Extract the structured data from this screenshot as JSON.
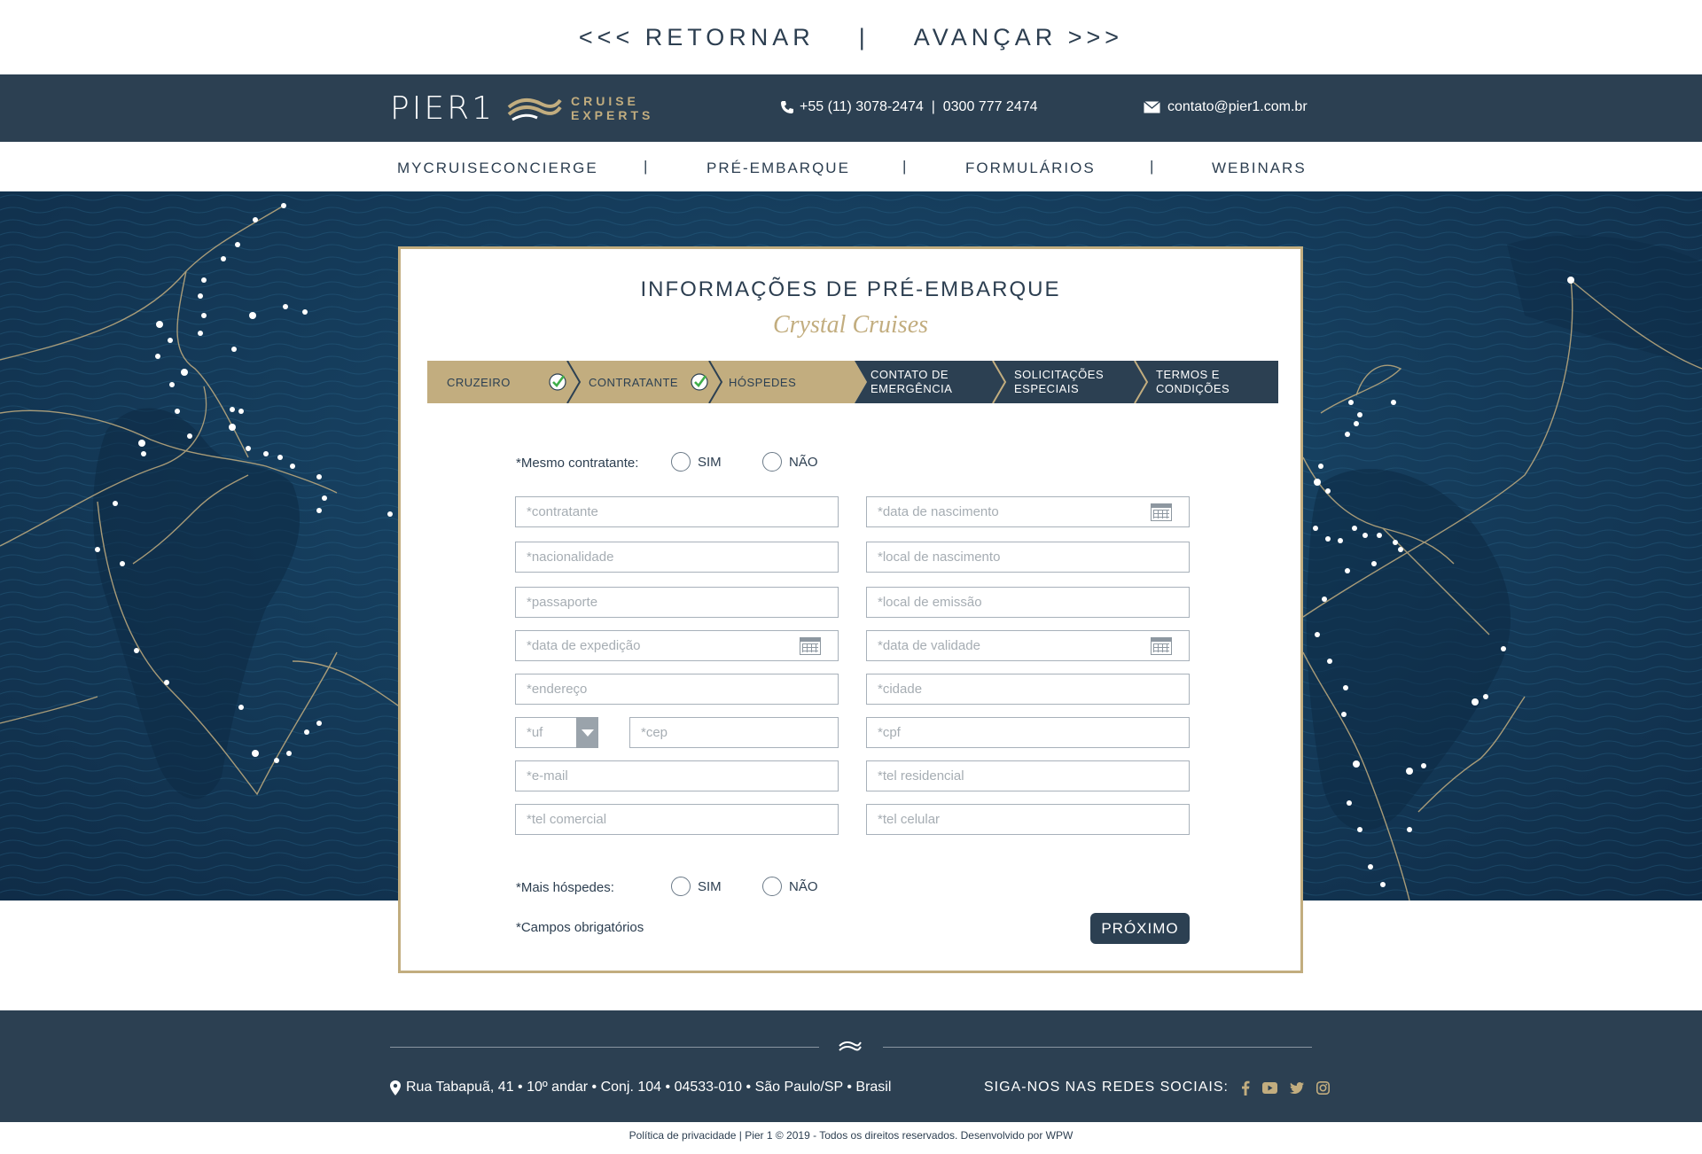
{
  "topnav": {
    "back": "<<< RETORNAR",
    "divider": "|",
    "forward": "AVANÇAR >>>"
  },
  "header": {
    "logo_main": "PIER1",
    "logo_sub_1": "CRUISE",
    "logo_sub_2": "EXPERTS",
    "phone": "+55 (11) 3078-2474  |  0300 777 2474",
    "email": "contato@pier1.com.br"
  },
  "menu": {
    "items": [
      "MYCRUISECONCIERGE",
      "PRÉ-EMBARQUE",
      "FORMULÁRIOS",
      "WEBINARS"
    ],
    "separator": "|"
  },
  "form": {
    "title": "INFORMAÇÕES DE PRÉ-EMBARQUE",
    "subtitle": "Crystal Cruises",
    "steps": [
      {
        "label": "CRUZEIRO",
        "done": true
      },
      {
        "label": "CONTRATANTE",
        "done": true
      },
      {
        "label": "HÓSPEDES",
        "done": false
      },
      {
        "label_1": "CONTATO DE",
        "label_2": "EMERGÊNCIA"
      },
      {
        "label_1": "SOLICITAÇÕES",
        "label_2": "ESPECIAIS"
      },
      {
        "label_1": "TERMOS E",
        "label_2": "CONDIÇÕES"
      }
    ],
    "same_contractor_label": "*Mesmo contratante:",
    "yes": "SIM",
    "no": "NÃO",
    "placeholders": {
      "contratante": "*contratante",
      "data_nascimento": "*data de nascimento",
      "nacionalidade": "*nacionalidade",
      "local_nascimento": "*local de nascimento",
      "passaporte": "*passaporte",
      "local_emissao": "*local de emissão",
      "data_expedicao": "*data de expedição",
      "data_validade": "*data de validade",
      "endereco": "*endereço",
      "cidade": "*cidade",
      "uf": "*uf",
      "cep": "*cep",
      "cpf": "*cpf",
      "email": "*e-mail",
      "tel_residencial": "*tel residencial",
      "tel_comercial": "*tel comercial",
      "tel_celular": "*tel celular"
    },
    "more_guests_label": "*Mais hóspedes:",
    "required_note": "*Campos obrigatórios",
    "next_button": "PRÓXIMO"
  },
  "footer": {
    "address": "Rua Tabapuã, 41 • 10º andar • Conj. 104 • 04533-010 • São Paulo/SP • Brasil",
    "social_label": "SIGA-NOS NAS REDES SOCIAIS:",
    "bottom_note": "Política de privacidade | Pier 1 © 2019 - Todos os direitos reservados. Desenvolvido por WPW"
  },
  "colors": {
    "navy": "#2c4052",
    "gold": "#c2ad7f",
    "step_done": "#c2ad7f",
    "step_todo": "#2c4052",
    "check_green": "#3fae49"
  }
}
